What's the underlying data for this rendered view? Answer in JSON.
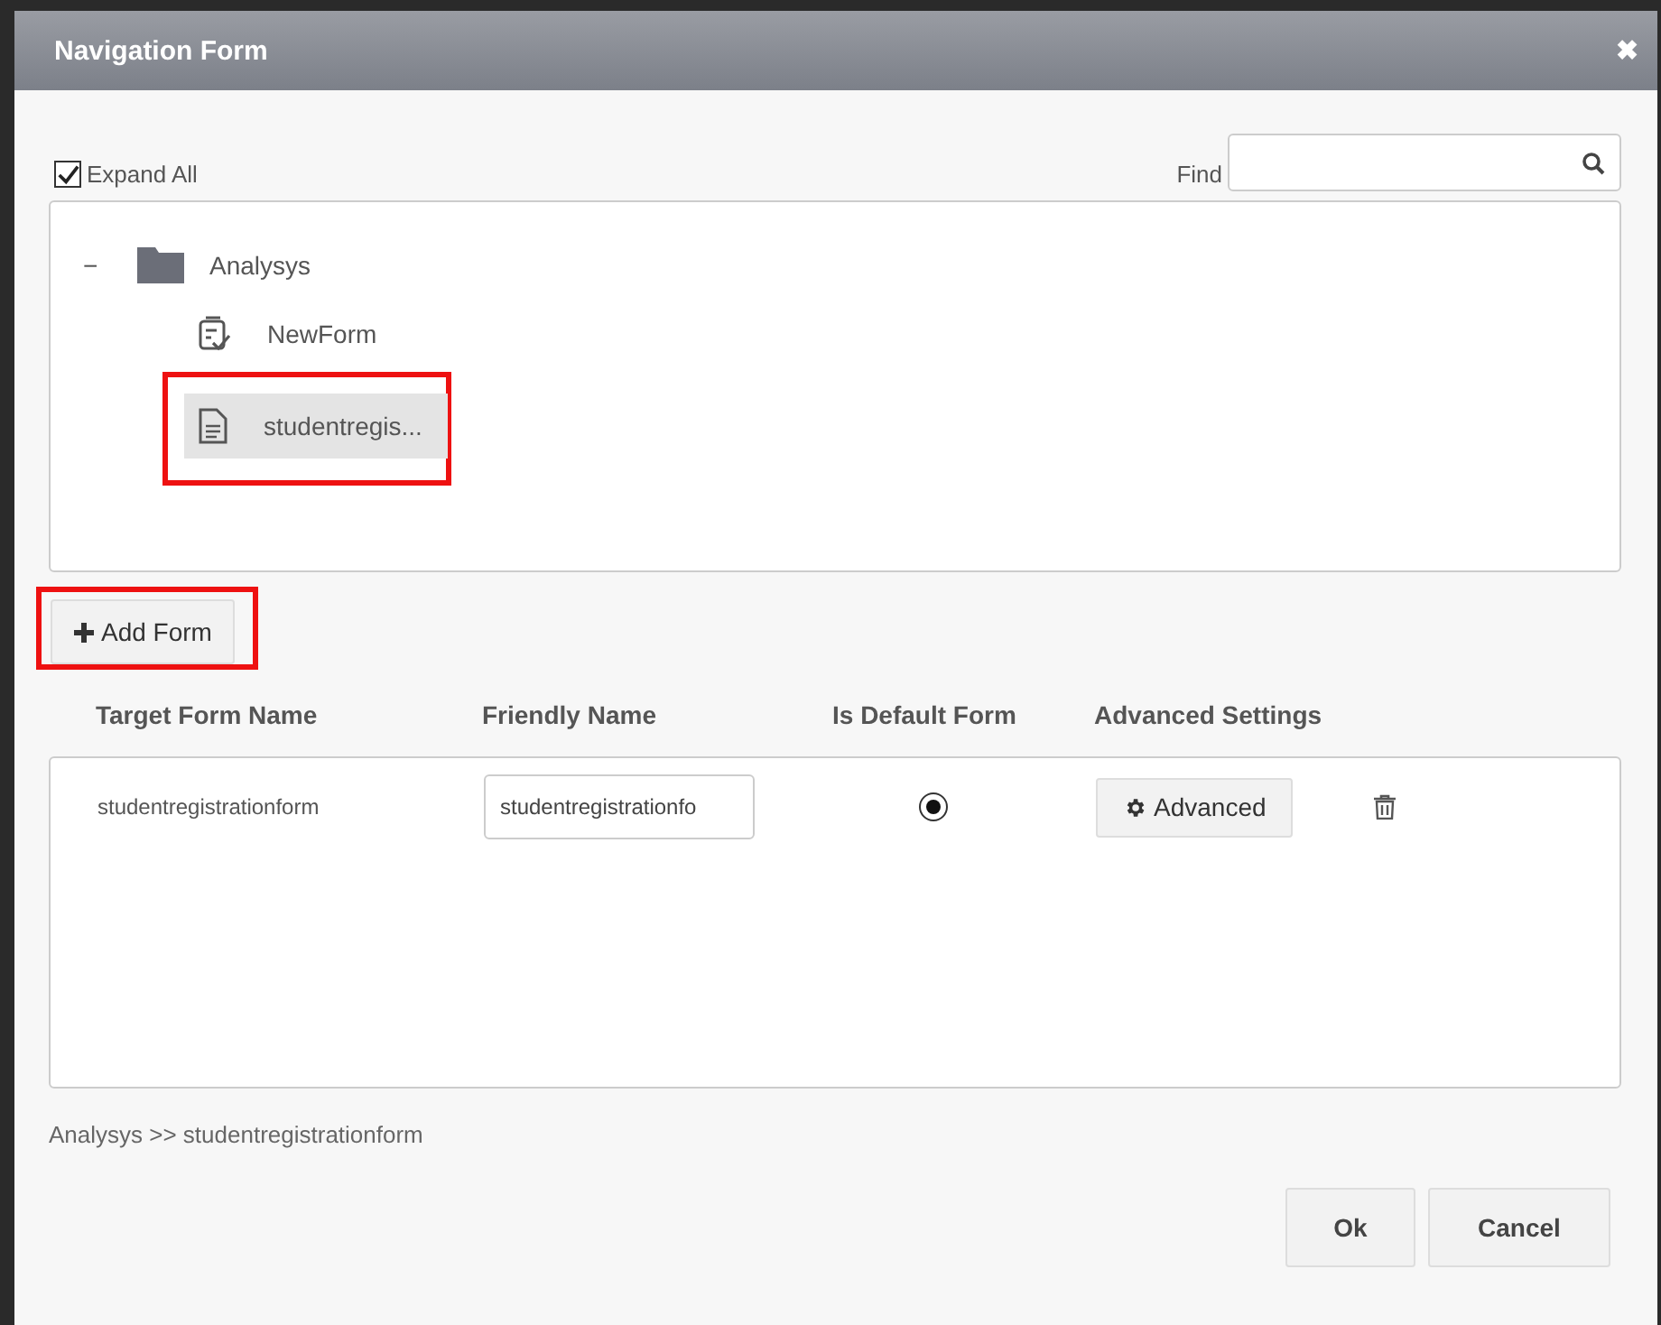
{
  "window": {
    "title": "Navigation Form",
    "close": "✖"
  },
  "expand_all": {
    "label": "Expand All",
    "checked": true
  },
  "find": {
    "label": "Find"
  },
  "tree": [
    {
      "label": "Analysys",
      "kind": "folder",
      "expanded": true,
      "toggle": "−",
      "selected": false,
      "children": [
        {
          "label": "NewForm",
          "kind": "checklist",
          "selected": false,
          "highlighted": false
        },
        {
          "label": "studentregis...",
          "kind": "document",
          "selected": true,
          "highlighted": true
        }
      ]
    }
  ],
  "add_form": {
    "label": "Add Form",
    "highlighted": true
  },
  "table": {
    "columns": [
      "Target Form Name",
      "Friendly Name",
      "Is Default Form",
      "Advanced Settings"
    ],
    "rows": [
      {
        "target": "studentregistrationform",
        "friendly": "studentregistrationfo",
        "default": true,
        "advanced": "Advanced"
      }
    ]
  },
  "breadcrumb": "Analysys >> studentregistrationform",
  "buttons": [
    "Ok",
    "Cancel"
  ]
}
